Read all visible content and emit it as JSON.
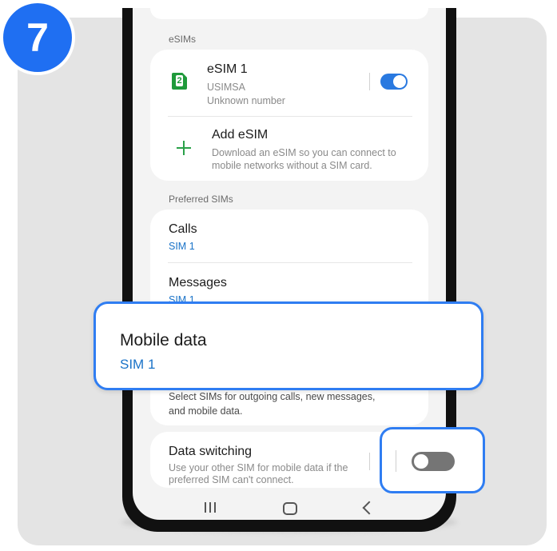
{
  "step_number": "7",
  "esims_section": {
    "label": "eSIMs",
    "esim1": {
      "title": "eSIM 1",
      "carrier": "USIMSA",
      "number": "Unknown number",
      "sim_slot": "2",
      "enabled": true
    },
    "add_esim": {
      "title": "Add eSIM",
      "description_line1": "Download an eSIM so you can connect to",
      "description_line2": "mobile networks without a SIM card."
    }
  },
  "preferred_sims": {
    "label": "Preferred SIMs",
    "calls": {
      "title": "Calls",
      "value": "SIM 1"
    },
    "messages": {
      "title": "Messages",
      "value": "SIM 1"
    },
    "mobile_data": {
      "title": "Mobile data",
      "value": "SIM 1"
    },
    "footer_line1": "Select SIMs for outgoing calls, new messages,",
    "footer_line2": "and mobile data."
  },
  "data_switching": {
    "title": "Data switching",
    "description_line1": "Use your other SIM for mobile data if the",
    "description_line2": "preferred SIM can't connect.",
    "enabled": false
  },
  "nav": {
    "recent": "recent-apps",
    "home": "home",
    "back": "back"
  },
  "colors": {
    "accent": "#2f7df2",
    "link": "#1a73c8",
    "sim_green": "#1f9a3b",
    "toggle_on": "#2979e0",
    "toggle_off": "#757575"
  }
}
